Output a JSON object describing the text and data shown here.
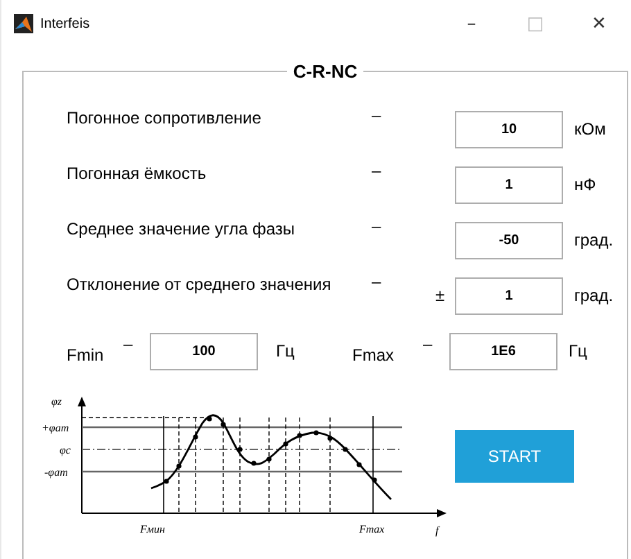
{
  "window": {
    "title": "Interfeis",
    "controls": [
      "–",
      "□",
      "✕"
    ]
  },
  "panel": {
    "title": "C-R-NC"
  },
  "params": [
    {
      "label": "Погонное сопротивление",
      "sep": "–",
      "value": "10",
      "unit": "кОм"
    },
    {
      "label": "Погонная ёмкость",
      "sep": "–",
      "value": "1",
      "unit": "нФ"
    },
    {
      "label": "Среднее значение угла фазы",
      "sep": "–",
      "value": "-50",
      "unit": "град."
    },
    {
      "label": "Отклонение от среднего значения",
      "sep": "–",
      "prefix": "±",
      "value": "1",
      "unit": "град."
    }
  ],
  "range": [
    {
      "label": "Fmin",
      "sep": "–",
      "value": "100",
      "unit": "Гц"
    },
    {
      "label": "Fmax",
      "sep": "–",
      "value": "1E6",
      "unit": "Гц"
    }
  ],
  "diagram": {
    "y_axis": "φz",
    "upper": "+φam",
    "center": "φc",
    "lower": "-φam",
    "f_min": "Fмин",
    "f_max": "Fmax",
    "x_axis": "f"
  },
  "start_button": "START"
}
